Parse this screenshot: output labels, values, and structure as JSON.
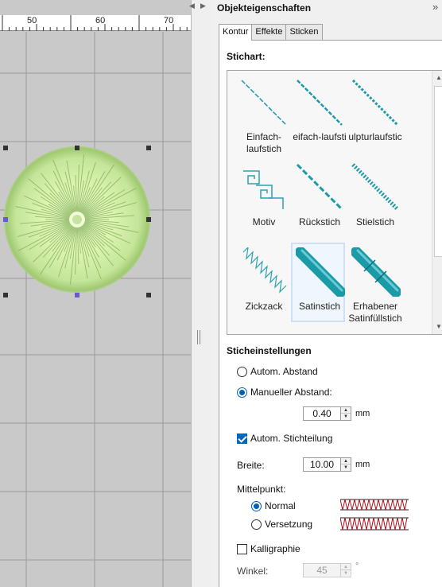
{
  "ruler": {
    "marks": [
      "50",
      "60",
      "70"
    ]
  },
  "panel": {
    "title": "Objekteigenschaften",
    "tabs": [
      "Kontur",
      "Effekte",
      "Sticken"
    ],
    "stitch_type_heading": "Stichart:",
    "stitch_types": [
      {
        "label": "Einfach-\nlaufstich",
        "icon": "single-run-stitch-icon"
      },
      {
        "label": "eifach-laufsti",
        "icon": "triple-run-stitch-icon"
      },
      {
        "label": "ulpturlaufstic",
        "icon": "sculpture-run-stitch-icon"
      },
      {
        "label": "Motiv",
        "icon": "motif-stitch-icon"
      },
      {
        "label": "Rückstich",
        "icon": "backstitch-icon"
      },
      {
        "label": "Stielstich",
        "icon": "stem-stitch-icon"
      },
      {
        "label": "Zickzack",
        "icon": "zigzag-stitch-icon"
      },
      {
        "label": "Satinstich",
        "icon": "satin-stitch-icon",
        "selected": true
      },
      {
        "label": "Erhabener\nSatinfüllstich",
        "icon": "raised-satin-stitch-icon"
      }
    ],
    "settings_heading": "Sticheinstellungen",
    "auto_spacing_label": "Autom. Abstand",
    "manual_spacing_label": "Manueller Abstand:",
    "spacing_value": "0.40",
    "mm_unit": "mm",
    "auto_split_label": "Autom. Stichteilung",
    "width_label": "Breite:",
    "width_value": "10.00",
    "center_label": "Mittelpunkt:",
    "normal_label": "Normal",
    "offset_label": "Versetzung",
    "calligraphy_label": "Kalligraphie",
    "angle_label": "Winkel:",
    "angle_value": "45",
    "degree_unit": "°"
  },
  "colors": {
    "accent": "#0067c0",
    "stitch_teal": "#1b9aa8",
    "zigzag_red": "#b0101c",
    "canvas_gray": "#c9c9c9",
    "embroidery_green": "#d6f0a5"
  }
}
